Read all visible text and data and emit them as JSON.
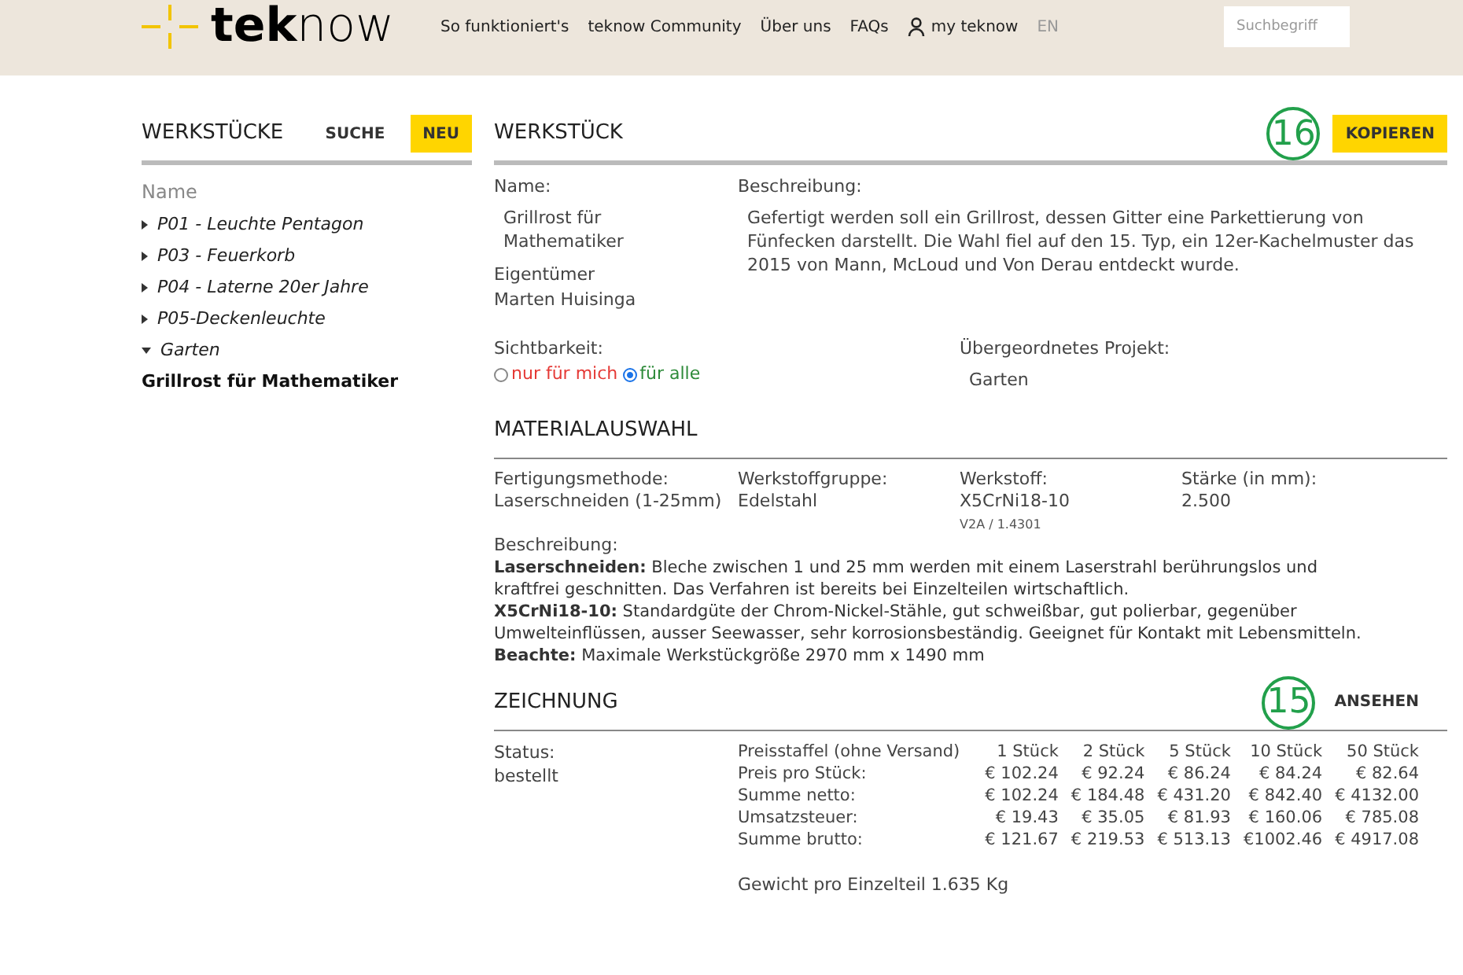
{
  "header": {
    "logo": {
      "bold": "tek",
      "light": "now"
    },
    "nav": [
      "So funktioniert's",
      "teknow Community",
      "Über uns",
      "FAQs"
    ],
    "account": "my teknow",
    "language": "EN",
    "search": {
      "placeholder": "Suchbegriff"
    }
  },
  "sidebar": {
    "title": "WERKSTÜCKE",
    "buttons": [
      {
        "label": "SUCHE",
        "kind": "plain"
      },
      {
        "label": "NEU",
        "kind": "primary"
      }
    ],
    "column": "Name",
    "tree": [
      {
        "label": "P01 - Leuchte Pentagon",
        "expanded": false
      },
      {
        "label": "P03 - Feuerkorb",
        "expanded": false
      },
      {
        "label": "P04 - Laterne 20er Jahre",
        "expanded": false
      },
      {
        "label": "P05-Deckenleuchte",
        "expanded": false
      },
      {
        "label": "Garten",
        "expanded": true,
        "children": [
          {
            "label": "Grillrost für Mathematiker",
            "selected": true
          }
        ]
      }
    ]
  },
  "workpiece": {
    "title": "WERKSTÜCK",
    "badge": "16",
    "action": "KOPIEREN",
    "name_label": "Name:",
    "name": "Grillrost für Mathematiker",
    "owner_label": "Eigentümer",
    "owner": "Marten Huisinga",
    "description_label": "Beschreibung:",
    "description": "Gefertigt werden soll ein Grillrost, dessen Gitter eine Parkettierung von Fünfecken darstellt. Die Wahl fiel auf den 15. Typ, ein 12er-Kachelmuster das 2015 von Mann, McLoud und Von Derau entdeckt wurde.",
    "visibility_label": "Sichtbarkeit:",
    "visibility": [
      {
        "label": "nur für mich",
        "selected": false,
        "color": "#e53935"
      },
      {
        "label": "für alle",
        "selected": true,
        "color": "#2e8b3a"
      }
    ],
    "parent_label": "Übergeordnetes Projekt:",
    "parent": "Garten"
  },
  "material": {
    "title": "MATERIALAUSWAHL",
    "fields": [
      {
        "label": "Fertigungsmethode:",
        "value": "Laserschneiden (1-25mm)"
      },
      {
        "label": "Werkstoffgruppe:",
        "value": "Edelstahl"
      },
      {
        "label": "Werkstoff:",
        "value": "X5CrNi18-10",
        "note": "V2A / 1.4301"
      },
      {
        "label": "Stärke (in mm):",
        "value": "2.500"
      }
    ],
    "description_label": "Beschreibung:",
    "description": [
      "**Laserschneiden:** Bleche zwischen 1 und 25 mm werden mit einem Laserstrahl berührungslos und kraftfrei geschnitten. Das Verfahren ist bereits bei Einzelteilen wirtschaftlich.",
      "**X5CrNi18-10:** Standardgüte der Chrom-Nickel-Stähle, gut schweißbar, gut polierbar, gegenüber Umwelteinflüssen, ausser Seewasser, sehr korrosionsbeständig. Geeignet für Kontakt mit Lebensmitteln.",
      "**Beachte:** Maximale Werkstückgröße 2970 mm x 1490 mm"
    ]
  },
  "drawing": {
    "title": "ZEICHNUNG",
    "badge": "15",
    "action": "ANSEHEN",
    "status_label": "Status:",
    "status": "bestellt",
    "price_table": {
      "columns": [
        "Preisstaffel (ohne Versand)",
        "1 Stück",
        "2 Stück",
        "5 Stück",
        "10 Stück",
        "50 Stück"
      ],
      "rows": [
        [
          "Preis pro Stück:",
          "€ 102.24",
          "€ 92.24",
          "€ 86.24",
          "€ 84.24",
          "€ 82.64"
        ],
        [
          "Summe netto:",
          "€ 102.24",
          "€ 184.48",
          "€ 431.20",
          "€ 842.40",
          "€ 4132.00"
        ],
        [
          "Umsatzsteuer:",
          "€ 19.43",
          "€ 35.05",
          "€ 81.93",
          "€ 160.06",
          "€ 785.08"
        ],
        [
          "Summe brutto:",
          "€ 121.67",
          "€ 219.53",
          "€ 513.13",
          "€1002.46",
          "€ 4917.08"
        ]
      ]
    },
    "weight": "Gewicht pro Einzelteil 1.635 Kg"
  }
}
